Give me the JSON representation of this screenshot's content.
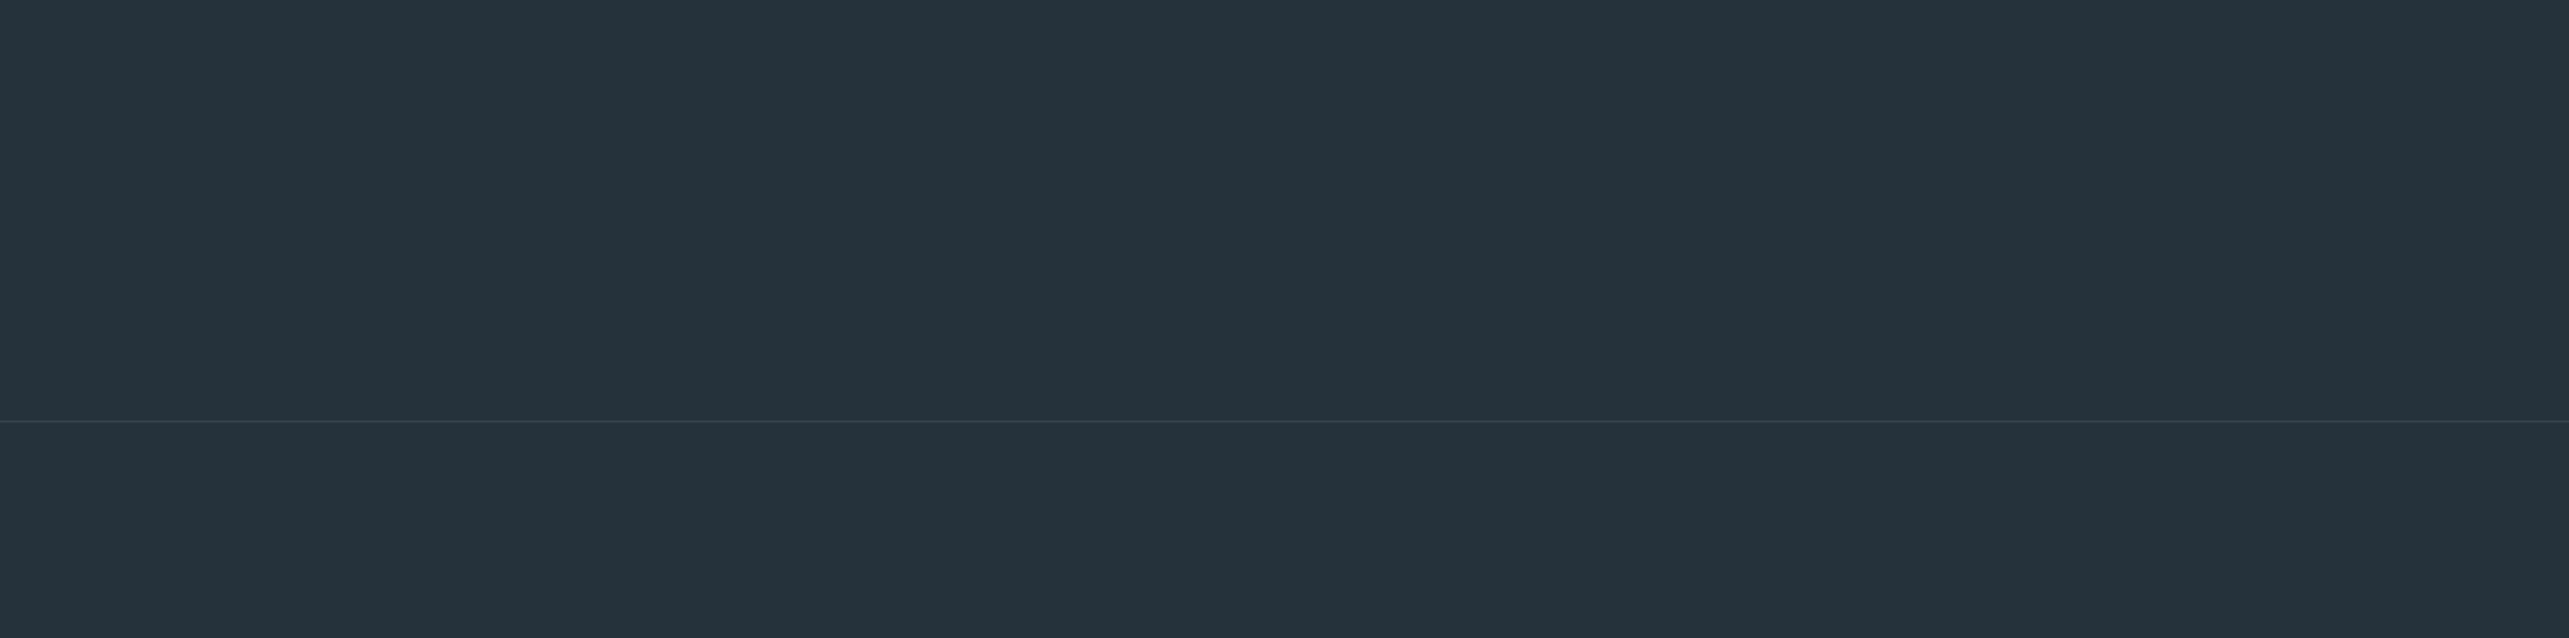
{
  "colors": {
    "background": "#29313a",
    "divider": "#35414c"
  }
}
